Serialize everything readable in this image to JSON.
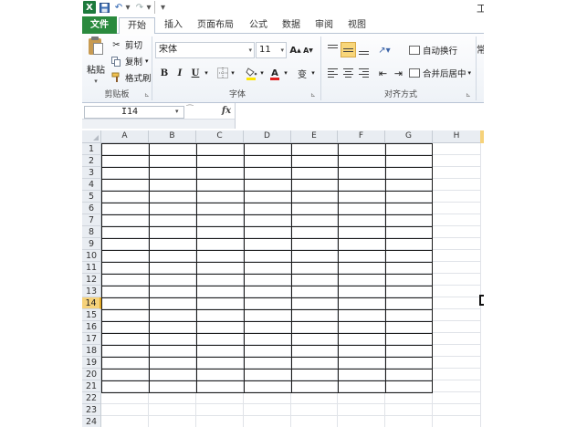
{
  "titlebar": {
    "excel_logo": "X",
    "save_icon": "💾",
    "undo_icon": "↶",
    "redo_icon": "↷",
    "dropdown": "▾",
    "customize": "▾",
    "title_fragment": "工"
  },
  "tabs": [
    {
      "label": "文件"
    },
    {
      "label": "开始"
    },
    {
      "label": "插入"
    },
    {
      "label": "页面布局"
    },
    {
      "label": "公式"
    },
    {
      "label": "数据"
    },
    {
      "label": "审阅"
    },
    {
      "label": "视图"
    }
  ],
  "clipboard": {
    "paste_label": "粘贴",
    "cut_label": "剪切",
    "copy_label": "复制",
    "painter_label": "格式刷",
    "group_label": "剪贴板"
  },
  "font": {
    "name": "宋体",
    "size": "11",
    "grow_label": "A",
    "shrink_label": "A",
    "bold_label": "B",
    "italic_label": "I",
    "underline_label": "U",
    "fontcolor_label": "A",
    "phonetic_label": "变",
    "group_label": "字体",
    "fill_color": "#ffe600",
    "font_color": "#e02020"
  },
  "alignment": {
    "wrap_label": "自动换行",
    "merge_label": "合并后居中",
    "group_label": "对齐方式",
    "edge_fragment": "常"
  },
  "formula_bar": {
    "name_box": "I14",
    "fx_label": "fx",
    "formula": ""
  },
  "sheet": {
    "columns": [
      "A",
      "B",
      "C",
      "D",
      "E",
      "F",
      "G",
      "H"
    ],
    "rows": [
      "1",
      "2",
      "3",
      "4",
      "5",
      "6",
      "7",
      "8",
      "9",
      "10",
      "11",
      "12",
      "13",
      "14",
      "15",
      "16",
      "17",
      "18",
      "19",
      "20",
      "21",
      "22",
      "23",
      "24"
    ],
    "selected_row": "14",
    "bordered_range": {
      "from_col": "A",
      "to_col": "G",
      "from_row": 1,
      "to_row": 21
    },
    "selection_color": "#f6d27a"
  }
}
